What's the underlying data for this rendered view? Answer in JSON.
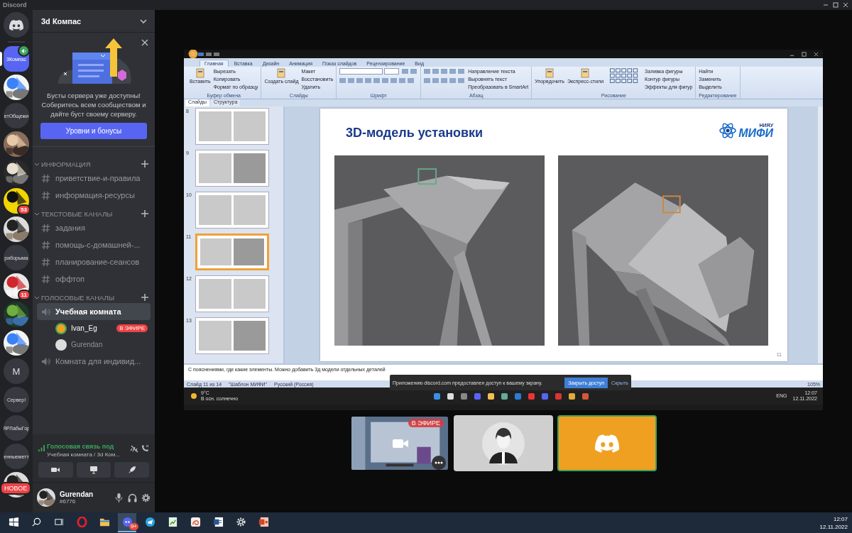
{
  "window": {
    "title": "Discord"
  },
  "servers": [
    {
      "kind": "home",
      "selected": false
    },
    {
      "kind": "label",
      "label": "3Компас",
      "selected": true,
      "voice": true
    },
    {
      "kind": "picture",
      "selected": false
    },
    {
      "kind": "label",
      "label": "етОбщежи",
      "selected": false
    },
    {
      "kind": "picture",
      "selected": false
    },
    {
      "kind": "picture",
      "selected": false
    },
    {
      "kind": "picture",
      "selected": false,
      "badge": "53"
    },
    {
      "kind": "picture",
      "selected": false
    },
    {
      "kind": "label",
      "label": "риборыма",
      "selected": false
    },
    {
      "kind": "picture",
      "selected": false,
      "badge": "11"
    },
    {
      "kind": "picture",
      "selected": false
    },
    {
      "kind": "picture",
      "selected": false
    },
    {
      "kind": "label",
      "label": "M",
      "selected": false
    },
    {
      "kind": "label",
      "label": "Сервер!",
      "selected": false
    },
    {
      "kind": "label",
      "label": "ЯРЛабыГор",
      "selected": false
    },
    {
      "kind": "label",
      "label": "енныеметт",
      "selected": false
    },
    {
      "kind": "picture",
      "selected": false,
      "badge": "НОВОЕ"
    }
  ],
  "server": {
    "name": "3d Компас"
  },
  "boost": {
    "text": "Бусты сервера уже доступны! Соберитесь всем сообществом и дайте буст своему серверу.",
    "button": "Уровни и бонусы"
  },
  "categories": [
    {
      "name": "ИНФОРМАЦИЯ",
      "expanded": true,
      "channels": [
        {
          "kind": "text",
          "name": "приветствие-и-правила",
          "selected": false
        },
        {
          "kind": "text",
          "name": "информация-ресурсы",
          "selected": false
        }
      ]
    },
    {
      "name": "ТЕКСТОВЫЕ КАНАЛЫ",
      "expanded": true,
      "channels": [
        {
          "kind": "text",
          "name": "задания",
          "selected": false
        },
        {
          "kind": "text",
          "name": "помощь-с-домашней-...",
          "selected": false
        },
        {
          "kind": "text",
          "name": "планирование-сеансов",
          "selected": false
        },
        {
          "kind": "text",
          "name": "оффтоп",
          "selected": false
        }
      ]
    },
    {
      "name": "ГОЛОСОВЫЕ КАНАЛЫ",
      "expanded": true,
      "channels": [
        {
          "kind": "voice",
          "name": "Учебная комната",
          "selected": true,
          "users": [
            {
              "name": "Ivan_Eg",
              "speaking": true,
              "badge": "В ЭФИРЕ"
            },
            {
              "name": "Gurendan",
              "speaking": false
            }
          ]
        },
        {
          "kind": "voice",
          "name": "Комната для индивид...",
          "selected": false
        }
      ]
    }
  ],
  "voice_panel": {
    "status": "Голосовая связь под",
    "location": "Учебная комната / 3d Ком..."
  },
  "user": {
    "name": "Gurendan",
    "tag": "#6776"
  },
  "shared_screen": {
    "tabs": [
      {
        "label": "Главная",
        "selected": true
      },
      {
        "label": "Вставка",
        "selected": false
      },
      {
        "label": "Дизайн",
        "selected": false
      },
      {
        "label": "Анимация",
        "selected": false
      },
      {
        "label": "Показ слайдов",
        "selected": false
      },
      {
        "label": "Рецензирование",
        "selected": false
      },
      {
        "label": "Вид",
        "selected": false
      }
    ],
    "ribbon_groups": [
      {
        "name": "Буфер обмена",
        "big": [
          "Вставить"
        ],
        "items": [
          "Вырезать",
          "Копировать",
          "Формат по образцу"
        ]
      },
      {
        "name": "Слайды",
        "big": [
          "Создать слайд"
        ],
        "items": [
          "Макет",
          "Восстановить",
          "Удалить"
        ]
      },
      {
        "name": "Шрифт"
      },
      {
        "name": "Абзац",
        "items": [
          "Направление текста",
          "Выровнять текст",
          "Преобразовать в SmartArt"
        ]
      },
      {
        "name": "Рисование",
        "big": [
          "Упорядочить",
          "Экспресс-стили"
        ],
        "items": [
          "Заливка фигуры",
          "Контур фигуры",
          "Эффекты для фигур"
        ]
      },
      {
        "name": "Редактирование",
        "items": [
          "Найти",
          "Заменить",
          "Выделить"
        ]
      }
    ],
    "panel_tabs": [
      {
        "label": "Слайды",
        "selected": true
      },
      {
        "label": "Структура",
        "selected": false
      }
    ],
    "thumbnails": [
      {
        "number": "8",
        "selected": false
      },
      {
        "number": "9",
        "selected": false
      },
      {
        "number": "10",
        "selected": false
      },
      {
        "number": "11",
        "selected": true
      },
      {
        "number": "12",
        "selected": false
      },
      {
        "number": "13",
        "selected": false
      }
    ],
    "slide": {
      "title": "3D-модель установки",
      "logo_small": "НИЯУ",
      "logo_main": "МИФИ",
      "page": "11"
    },
    "notes": "С пояснениями, где какие элементы. Можно добавить 3д модели отдельных деталей",
    "share_notice": {
      "text": "Приложению discord.com предоставлен доступ к вашему экрану.",
      "primary": "Закрыть доступ",
      "secondary": "Скрыть"
    },
    "status": [
      "Слайд 11 из 14",
      "\"Шаблон МИФИ\"",
      "Русский (Россия)"
    ],
    "zoom": "105%",
    "os_taskbar": {
      "temp": "9°C",
      "weather": "В осн. солнечно",
      "lang": "ENG",
      "time": "12:07",
      "date": "12.11.2022"
    }
  },
  "tiles": [
    {
      "kind": "screen",
      "badge": "В ЭФИРЕ",
      "speaking": false
    },
    {
      "kind": "avatar",
      "speaking": false
    },
    {
      "kind": "logo",
      "speaking": true
    }
  ],
  "taskbar": {
    "apps": [
      {
        "kind": "ring",
        "selected": false
      },
      {
        "kind": "folder",
        "selected": false
      },
      {
        "kind": "logo",
        "selected": true,
        "badge": "9+"
      },
      {
        "kind": "plane",
        "selected": false
      },
      {
        "kind": "chart",
        "selected": false
      },
      {
        "kind": "swirl",
        "selected": false
      },
      {
        "kind": "doc",
        "selected": false
      },
      {
        "kind": "gear",
        "selected": false
      },
      {
        "kind": "slides",
        "selected": false
      }
    ],
    "time": "12:07",
    "date": "12.11.2022"
  }
}
